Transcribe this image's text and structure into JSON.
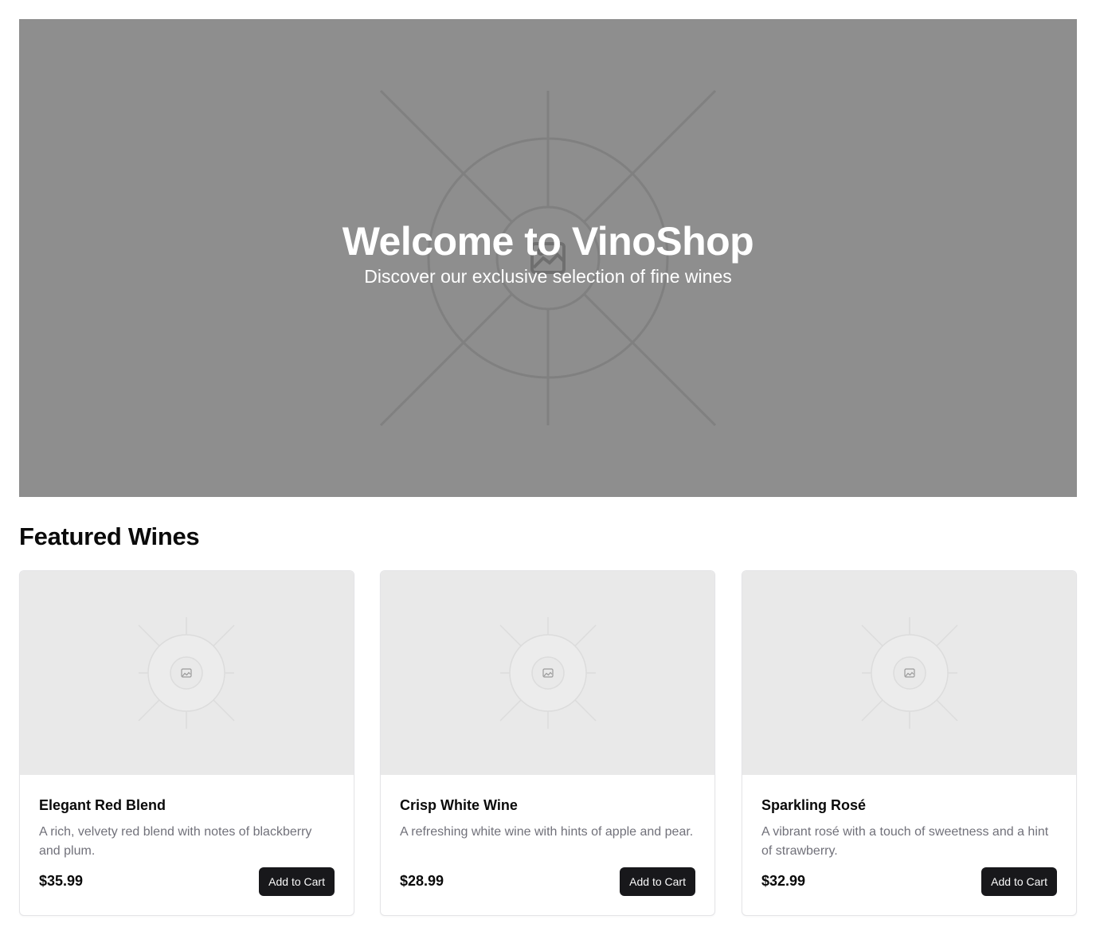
{
  "hero": {
    "title": "Welcome to VinoShop",
    "subtitle": "Discover our exclusive selection of fine wines",
    "image_icon": "image-placeholder-icon",
    "background": "#8e8e8e"
  },
  "featured": {
    "title": "Featured Wines",
    "products": [
      {
        "name": "Elegant Red Blend",
        "description": "A rich, velvety red blend with notes of blackberry and plum.",
        "price": "$35.99",
        "button_label": "Add to Cart",
        "image_icon": "image-placeholder-icon"
      },
      {
        "name": "Crisp White Wine",
        "description": "A refreshing white wine with hints of apple and pear.",
        "price": "$28.99",
        "button_label": "Add to Cart",
        "image_icon": "image-placeholder-icon"
      },
      {
        "name": "Sparkling Rosé",
        "description": "A vibrant rosé with a touch of sweetness and a hint of strawberry.",
        "price": "$32.99",
        "button_label": "Add to Cart",
        "image_icon": "image-placeholder-icon"
      }
    ]
  },
  "colors": {
    "button_bg": "#18181b",
    "button_text": "#fafafa",
    "muted_text": "#71717a",
    "card_image_bg": "#e9e9e9"
  }
}
